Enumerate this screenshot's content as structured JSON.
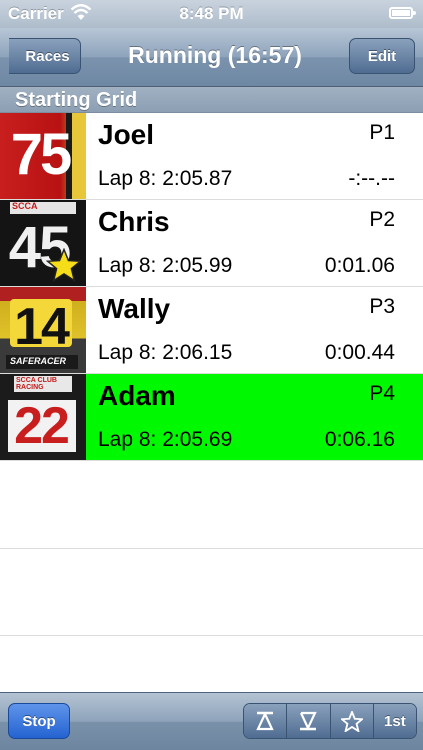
{
  "status_bar": {
    "carrier": "Carrier",
    "time": "8:48 PM"
  },
  "nav": {
    "back_label": "Races",
    "title": "Running (16:57)",
    "edit_label": "Edit"
  },
  "section": {
    "title": "Starting Grid"
  },
  "drivers": [
    {
      "number": "75",
      "name": "Joel",
      "position": "P1",
      "lap": "Lap 8: 2:05.87",
      "gap": "-:--.--",
      "selected": false
    },
    {
      "number": "45",
      "name": "Chris",
      "position": "P2",
      "lap": "Lap 8: 2:05.99",
      "gap": "0:01.06",
      "selected": false
    },
    {
      "number": "14",
      "name": "Wally",
      "position": "P3",
      "lap": "Lap 8: 2:06.15",
      "gap": "0:00.44",
      "selected": false
    },
    {
      "number": "22",
      "name": "Adam",
      "position": "P4",
      "lap": "Lap 8: 2:05.69",
      "gap": "0:06.16",
      "selected": true
    }
  ],
  "thumb_text": {
    "scca": "SCCA",
    "saferacer": "SAFERACER",
    "scca_club_racing": "SCCA CLUB RACING"
  },
  "toolbar": {
    "stop_label": "Stop",
    "segments": [
      "move-up-icon",
      "move-down-icon",
      "star-icon",
      "1st"
    ],
    "first_label": "1st"
  },
  "colors": {
    "selected_row": "#00f900",
    "stop_button": "#2463d0"
  }
}
